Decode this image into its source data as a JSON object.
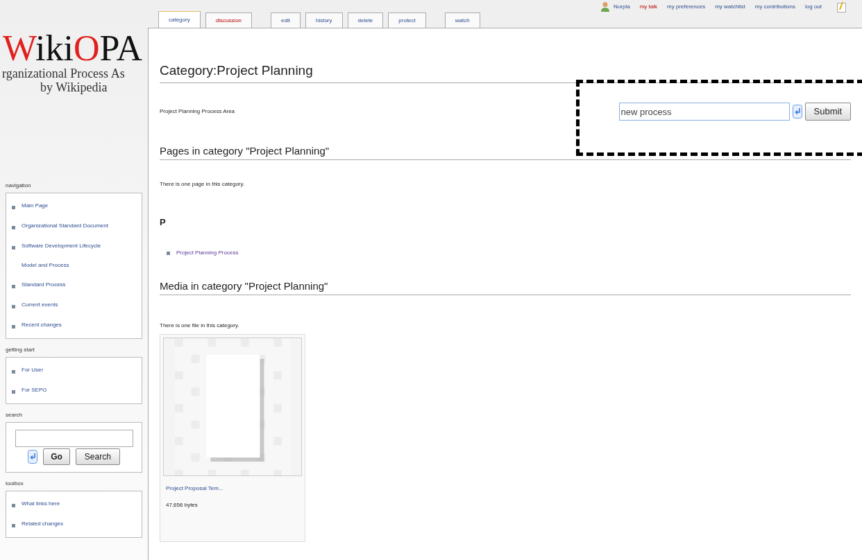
{
  "personal_links": [
    {
      "label": "Nurpla",
      "exists": true,
      "kind": "user"
    },
    {
      "label": "my talk",
      "exists": false,
      "kind": "link"
    },
    {
      "label": "my preferences",
      "exists": true,
      "kind": "link"
    },
    {
      "label": "my watchlist",
      "exists": true,
      "kind": "link"
    },
    {
      "label": "my contributions",
      "exists": true,
      "kind": "link"
    },
    {
      "label": "log out",
      "exists": true,
      "kind": "link"
    }
  ],
  "logo": {
    "parts": [
      {
        "text": "W",
        "color": "#e0201c"
      },
      {
        "text": "iki",
        "color": "#111111"
      },
      {
        "text": "O",
        "color": "#e0201c"
      },
      {
        "text": "PA",
        "color": "#111111"
      }
    ],
    "subtitle": "rganizational Process As",
    "tagline": "by Wikipedia"
  },
  "tabs": [
    {
      "label": "category",
      "selected": true,
      "exists": true
    },
    {
      "label": "discussion",
      "selected": false,
      "exists": false
    },
    {
      "label": "edit",
      "selected": false,
      "exists": true
    },
    {
      "label": "history",
      "selected": false,
      "exists": true
    },
    {
      "label": "delete",
      "selected": false,
      "exists": true
    },
    {
      "label": "protect",
      "selected": false,
      "exists": true
    },
    {
      "label": "watch",
      "selected": false,
      "exists": true
    }
  ],
  "sidebar": [
    {
      "title": "navigation",
      "kind": "links",
      "items": [
        "Main Page",
        "Organizational Standard Document",
        "Software Development Lifecycle Model and Process",
        "Standard Process",
        "Current events",
        "Recent changes"
      ]
    },
    {
      "title": "getting start",
      "kind": "links",
      "items": [
        "For User",
        "For SEPG"
      ]
    },
    {
      "title": "search",
      "kind": "search",
      "buttons": [
        "Go",
        "Search"
      ]
    },
    {
      "title": "toolbox",
      "kind": "links",
      "items": [
        "What links here",
        "Related changes"
      ]
    }
  ],
  "content": {
    "title": "Category:Project Planning",
    "intro": "Project Planning Process Area",
    "form": {
      "value": "new process",
      "button": "Submit"
    },
    "pages_heading": "Pages in category \"Project Planning\"",
    "pages_count": "There is one page in this category.",
    "letter": "P",
    "pages": [
      "Project Planning Process"
    ],
    "media_heading": "Media in category \"Project Planning\"",
    "media_count": "There is one file in this category.",
    "files": [
      {
        "name": "Project Proposal Tem...",
        "size": "47,656 bytes"
      }
    ]
  }
}
